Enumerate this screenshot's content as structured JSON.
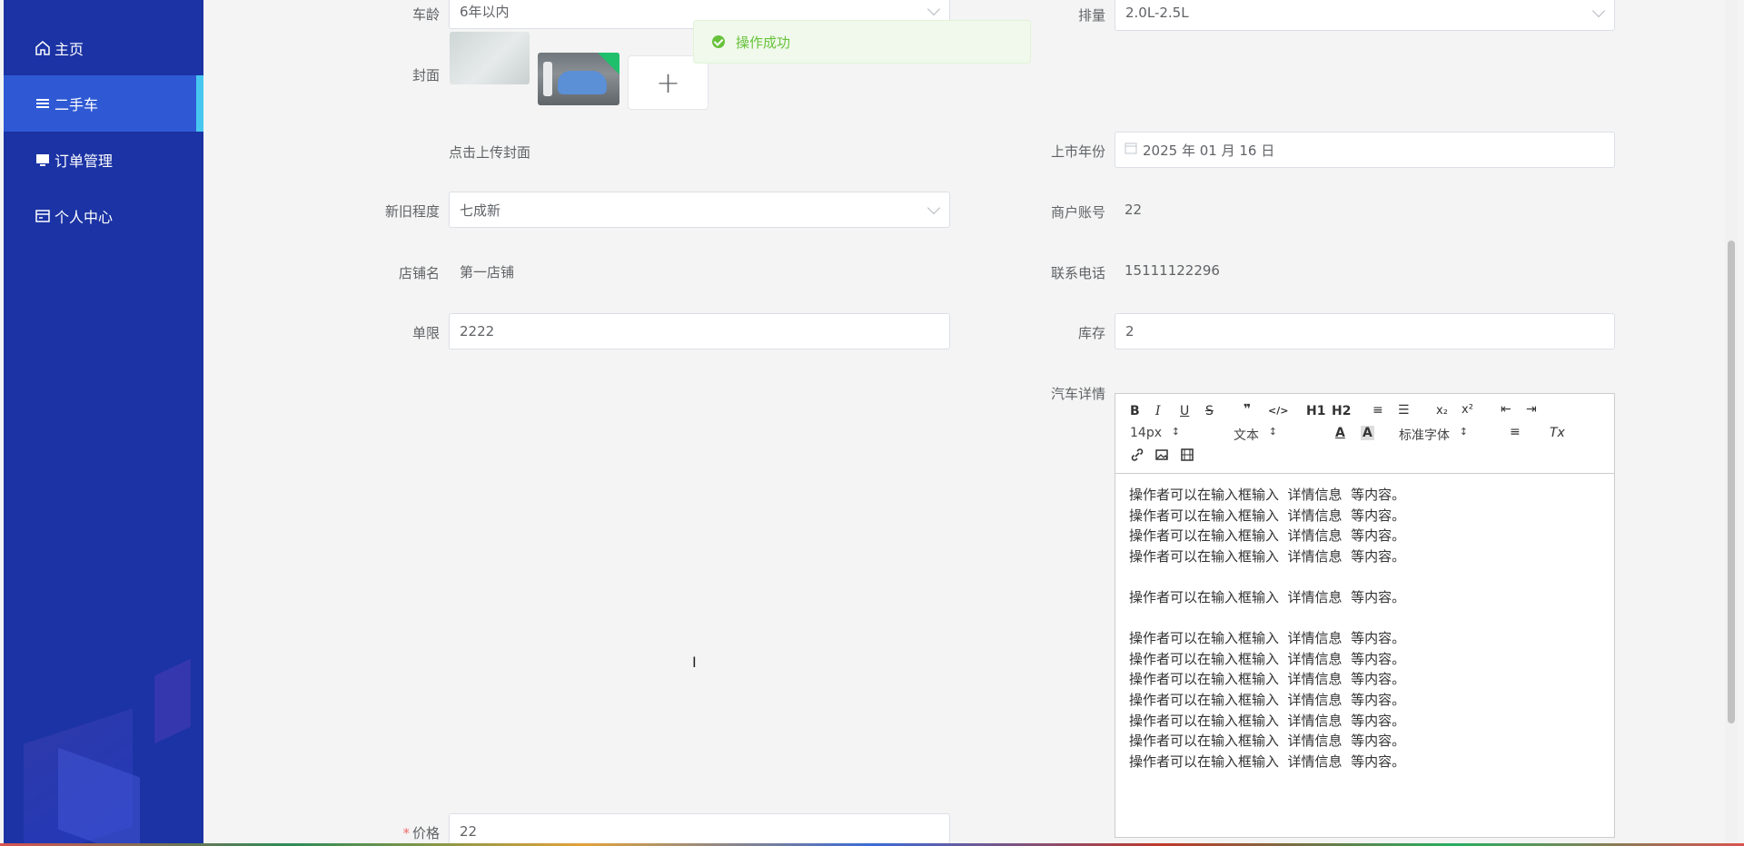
{
  "sidebar": {
    "items": [
      {
        "label": "主页",
        "icon": "home-icon"
      },
      {
        "label": "二手车",
        "icon": "list-icon",
        "active": true
      },
      {
        "label": "订单管理",
        "icon": "monitor-icon"
      },
      {
        "label": "个人中心",
        "icon": "id-card-icon"
      }
    ]
  },
  "toast": {
    "message": "操作成功",
    "color": "#67c23a"
  },
  "form": {
    "car_age": {
      "label": "车龄",
      "value": "6年以内"
    },
    "displacement": {
      "label": "排量",
      "value": "2.0L-2.5L"
    },
    "cover": {
      "label": "封面",
      "hint": "点击上传封面",
      "upload_symbol": "+"
    },
    "launch_year": {
      "label": "上市年份",
      "value": "2025 年 01 月 16 日"
    },
    "condition": {
      "label": "新旧程度",
      "value": "七成新"
    },
    "merchant_account": {
      "label": "商户账号",
      "value": "22"
    },
    "shop_name": {
      "label": "店铺名",
      "value": "第一店铺"
    },
    "phone": {
      "label": "联系电话",
      "value": "15111122296"
    },
    "limit": {
      "label": "单限",
      "value": "2222"
    },
    "stock": {
      "label": "库存",
      "value": "2"
    },
    "details": {
      "label": "汽车详情"
    },
    "price": {
      "label": "价格",
      "required_mark": "*",
      "value": "22"
    }
  },
  "editor": {
    "toolbar": {
      "bold": "B",
      "italic": "I",
      "underline": "U",
      "strike": "S",
      "quote": "❞",
      "code": "</>",
      "h1": "H1",
      "h2": "H2",
      "ordered_list": "≡",
      "bullet_list": "☰",
      "sub": "x₂",
      "sup": "x²",
      "outdent": "⇤",
      "indent": "⇥",
      "size": "14px",
      "header": "文本",
      "font_color": "A",
      "background": "A",
      "font": "标准字体",
      "align": "≡",
      "clean": "Tx"
    },
    "lines": [
      "操作者可以在输入框输入  详情信息  等内容。",
      "操作者可以在输入框输入  详情信息  等内容。",
      "操作者可以在输入框输入  详情信息  等内容。",
      "操作者可以在输入框输入  详情信息  等内容。",
      "",
      "操作者可以在输入框输入  详情信息  等内容。",
      "",
      "操作者可以在输入框输入  详情信息  等内容。",
      "操作者可以在输入框输入  详情信息  等内容。",
      "操作者可以在输入框输入  详情信息  等内容。",
      "操作者可以在输入框输入  详情信息  等内容。",
      "操作者可以在输入框输入  详情信息  等内容。",
      "操作者可以在输入框输入  详情信息  等内容。",
      "操作者可以在输入框输入  详情信息  等内容。"
    ]
  },
  "colors": {
    "sidebar_bg": "#1b33a4",
    "sidebar_active": "#2f59d4",
    "active_bar": "#47c6f0"
  }
}
